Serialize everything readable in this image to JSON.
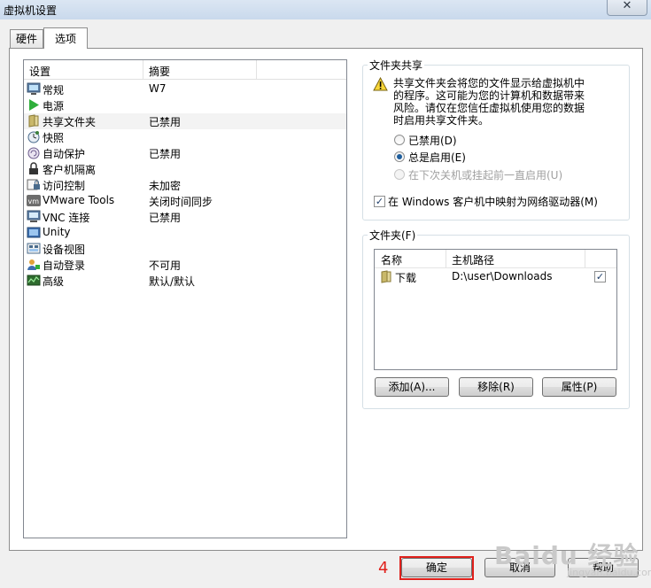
{
  "window": {
    "title": "虚拟机设置",
    "close_label": "✕"
  },
  "tabs": [
    {
      "label": "硬件"
    },
    {
      "label": "选项",
      "active": true
    }
  ],
  "settings_list": {
    "headers": [
      "设置",
      "摘要"
    ],
    "items": [
      {
        "icon": "monitor-icon",
        "label": "常规",
        "summary": "W7"
      },
      {
        "icon": "power-play-icon",
        "label": "电源",
        "summary": ""
      },
      {
        "icon": "shared-folder-icon",
        "label": "共享文件夹",
        "summary": "已禁用",
        "selected": true
      },
      {
        "icon": "snapshot-clock-icon",
        "label": "快照",
        "summary": ""
      },
      {
        "icon": "autoprotect-icon",
        "label": "自动保护",
        "summary": "已禁用"
      },
      {
        "icon": "lock-icon",
        "label": "客户机隔离",
        "summary": ""
      },
      {
        "icon": "access-control-icon",
        "label": "访问控制",
        "summary": "未加密"
      },
      {
        "icon": "vmware-tools-icon",
        "label": "VMware Tools",
        "summary": "关闭时间同步"
      },
      {
        "icon": "vnc-icon",
        "label": "VNC 连接",
        "summary": "已禁用"
      },
      {
        "icon": "unity-icon",
        "label": "Unity",
        "summary": ""
      },
      {
        "icon": "device-view-icon",
        "label": "设备视图",
        "summary": ""
      },
      {
        "icon": "autologin-icon",
        "label": "自动登录",
        "summary": "不可用"
      },
      {
        "icon": "advanced-icon",
        "label": "高级",
        "summary": "默认/默认"
      }
    ]
  },
  "sharing": {
    "group_title": "文件夹共享",
    "warning_lines": [
      "共享文件夹会将您的文件显示给虚拟机中",
      "的程序。这可能为您的计算机和数据带来",
      "风险。请仅在您信任虚拟机使用您的数据",
      "时启用共享文件夹。"
    ],
    "options": [
      {
        "label": "已禁用(D)",
        "checked": false,
        "disabled": false
      },
      {
        "label": "总是启用(E)",
        "checked": true,
        "disabled": false
      },
      {
        "label": "在下次关机或挂起前一直启用(U)",
        "checked": false,
        "disabled": true
      }
    ],
    "map_drive_label": "在 Windows 客户机中映射为网络驱动器(M)",
    "map_drive_checked": true
  },
  "folders": {
    "group_title": "文件夹(F)",
    "headers": [
      "名称",
      "主机路径"
    ],
    "rows": [
      {
        "name": "下载",
        "path": "D:\\user\\Downloads",
        "enabled": true
      }
    ],
    "buttons": {
      "add": "添加(A)...",
      "remove": "移除(R)",
      "properties": "属性(P)"
    }
  },
  "footer": {
    "ok": "确定",
    "cancel": "取消",
    "help": "帮助"
  },
  "annotation": {
    "step": "4",
    "color": "#e0211c"
  },
  "watermark": {
    "text": "Baidu 经验",
    "sub": "jingyan.baidu.com"
  }
}
